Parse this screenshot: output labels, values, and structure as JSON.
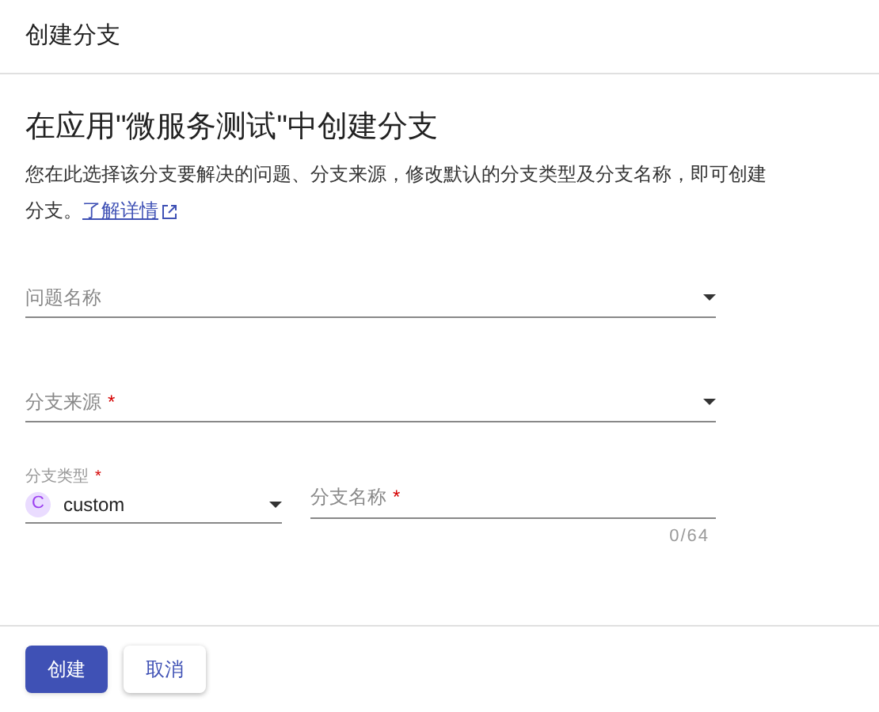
{
  "header": {
    "title": "创建分支"
  },
  "heading": "在应用\"微服务测试\"中创建分支",
  "description": {
    "text": "您在此选择该分支要解决的问题、分支来源，修改默认的分支类型及分支名称，即可创建分支。",
    "link": "了解详情"
  },
  "fields": [
    {
      "placeholder": "问题名称"
    },
    {
      "placeholder": "分支来源",
      "required_mark": "*"
    }
  ],
  "branch_type": {
    "label": "分支类型",
    "required_mark": "*",
    "badge": "C",
    "value": "custom"
  },
  "branch_name": {
    "placeholder": "分支名称",
    "required_mark": "*",
    "counter": "0/64"
  },
  "buttons": [
    {
      "label": "创建",
      "kind": "primary"
    },
    {
      "label": "取消",
      "kind": "secondary"
    }
  ]
}
